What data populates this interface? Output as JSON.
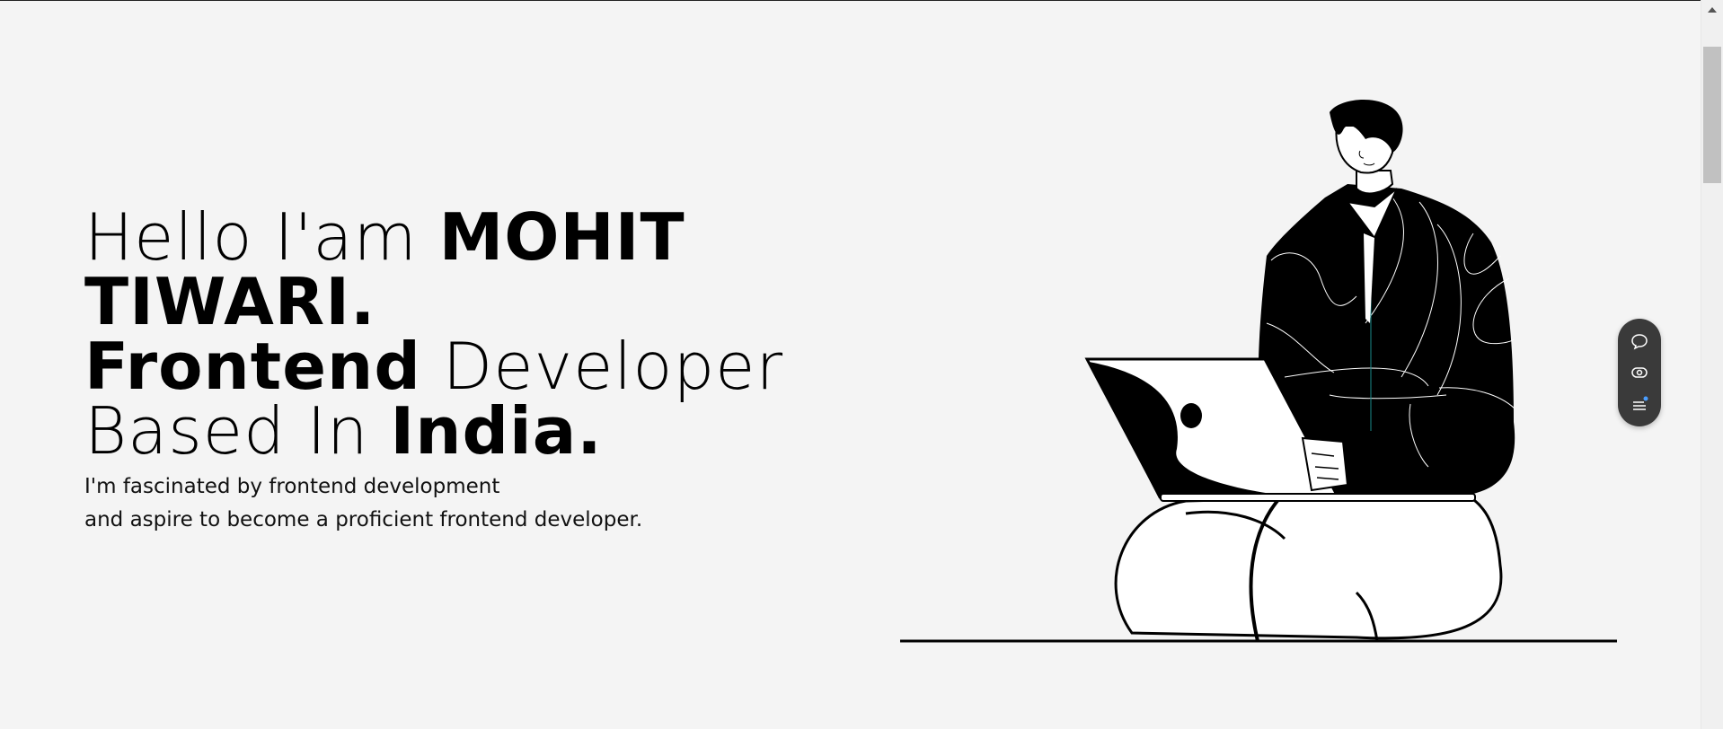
{
  "hero": {
    "greeting": "Hello I'am",
    "name_part1": "MOHIT",
    "name_part2": "TIWARI.",
    "role_bold": "Frontend",
    "role_light": "Developer",
    "based_in": "Based In",
    "country": "India.",
    "description_line1": "I'm fascinated by frontend development",
    "description_line2": "and aspire to become a proficient frontend developer."
  },
  "widget": {
    "items": [
      {
        "icon": "chat-bubble-icon"
      },
      {
        "icon": "eye-icon"
      },
      {
        "icon": "menu-notification-icon"
      }
    ],
    "background": "#3a3a3a",
    "accent": "#4a9eff"
  },
  "colors": {
    "background": "#f4f4f4",
    "text": "#000000"
  }
}
